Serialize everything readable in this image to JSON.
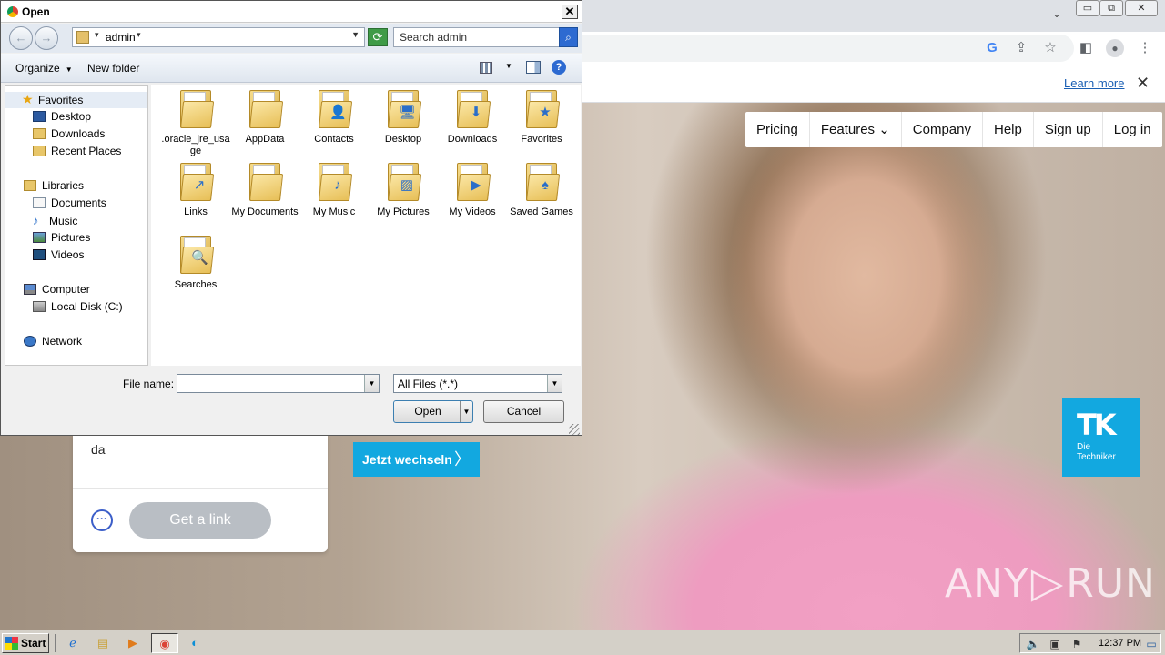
{
  "browser": {
    "window_controls": [
      "▭",
      "⧉",
      "✕"
    ],
    "infobar": {
      "learn_more": "Learn more",
      "close": "✕"
    },
    "site_nav": [
      "Pricing",
      "Features ⌄",
      "Company",
      "Help",
      "Sign up",
      "Log in"
    ],
    "cta": {
      "label": "Jetzt wechseln",
      "arrow": "〉"
    },
    "logo": {
      "mark": "TK",
      "line1": "Die",
      "line2": "Techniker"
    },
    "card": {
      "text": "da",
      "more": "···",
      "button": "Get a link"
    },
    "watermark": {
      "left": "ANY",
      "right": "RUN",
      "play": "▷"
    }
  },
  "dialog": {
    "title": "Open",
    "close": "✕",
    "address": "admin",
    "search_placeholder": "Search admin",
    "toolbar": {
      "organize": "Organize",
      "new_folder": "New folder",
      "help": "?"
    },
    "nav_pane": {
      "favorites": "Favorites",
      "favorites_items": [
        "Desktop",
        "Downloads",
        "Recent Places"
      ],
      "libraries": "Libraries",
      "libraries_items": [
        "Documents",
        "Music",
        "Pictures",
        "Videos"
      ],
      "computer": "Computer",
      "computer_items": [
        "Local Disk (C:)"
      ],
      "network": "Network"
    },
    "files": [
      {
        "label": ".oracle_jre_usage",
        "emblem": ""
      },
      {
        "label": "AppData",
        "emblem": ""
      },
      {
        "label": "Contacts",
        "emblem": "👤"
      },
      {
        "label": "Desktop",
        "emblem": "🖥"
      },
      {
        "label": "Downloads",
        "emblem": "⬇"
      },
      {
        "label": "Favorites",
        "emblem": "★"
      },
      {
        "label": "Links",
        "emblem": "↗"
      },
      {
        "label": "My Documents",
        "emblem": ""
      },
      {
        "label": "My Music",
        "emblem": "♪"
      },
      {
        "label": "My Pictures",
        "emblem": "▨"
      },
      {
        "label": "My Videos",
        "emblem": "▶"
      },
      {
        "label": "Saved Games",
        "emblem": "♠"
      },
      {
        "label": "Searches",
        "emblem": "🔍"
      }
    ],
    "file_name_label": "File name:",
    "file_name_value": "",
    "file_type": "All Files (*.*)",
    "open_button": "Open",
    "cancel_button": "Cancel"
  },
  "taskbar": {
    "start": "Start",
    "clock": "12:37 PM"
  }
}
